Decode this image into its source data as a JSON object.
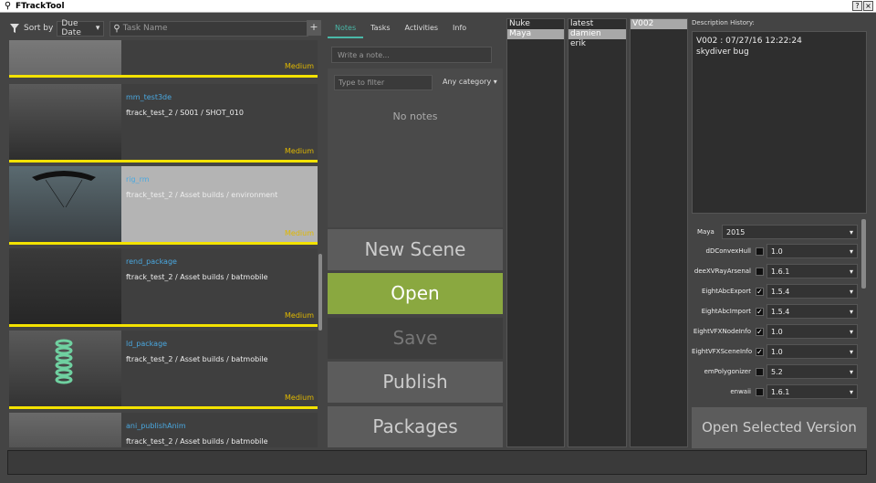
{
  "window": {
    "title": "FTrackTool",
    "help": "?",
    "close": "×"
  },
  "toolbar": {
    "sort_label": "Sort by",
    "sort_value": "Due Date",
    "search_placeholder": "Task Name",
    "add": "+"
  },
  "tasks": [
    {
      "name": "",
      "path": "",
      "priority": "Medium"
    },
    {
      "name": "mm_test3de",
      "path": "ftrack_test_2 / S001 / SHOT_010",
      "priority": "Medium"
    },
    {
      "name": "rig_rm",
      "path": "ftrack_test_2 / Asset builds / environment",
      "priority": "Medium"
    },
    {
      "name": "rend_package",
      "path": "ftrack_test_2 / Asset builds / batmobile",
      "priority": "Medium"
    },
    {
      "name": "ld_package",
      "path": "ftrack_test_2 / Asset builds / batmobile",
      "priority": "Medium"
    },
    {
      "name": "ani_publishAnim",
      "path": "ftrack_test_2 / Asset builds / batmobile",
      "priority": ""
    }
  ],
  "notes": {
    "tabs": [
      "Notes",
      "Tasks",
      "Activities",
      "Info"
    ],
    "write_placeholder": "Write a note...",
    "filter_placeholder": "Type to filter",
    "category": "Any category",
    "empty": "No notes"
  },
  "actions": {
    "new_scene": "New Scene",
    "open": "Open",
    "save": "Save",
    "publish": "Publish",
    "packages": "Packages"
  },
  "apps": [
    "Nuke",
    "Maya"
  ],
  "users": [
    "latest",
    "damien",
    "erik"
  ],
  "versions": [
    "V002"
  ],
  "description": {
    "label": "Description History:",
    "line1": "V002 : 07/27/16 12:22:24",
    "line2": "skydiver bug"
  },
  "maya": {
    "label": "Maya",
    "version": "2015"
  },
  "plugins": [
    {
      "name": "dDConvexHull",
      "checked": "",
      "version": "1.0"
    },
    {
      "name": "deeXVRayArsenal",
      "checked": "",
      "version": "1.6.1"
    },
    {
      "name": "EightAbcExport",
      "checked": "✓",
      "version": "1.5.4"
    },
    {
      "name": "EightAbcImport",
      "checked": "✓",
      "version": "1.5.4"
    },
    {
      "name": "EightVFXNodeInfo",
      "checked": "✓",
      "version": "1.0"
    },
    {
      "name": "EightVFXSceneInfo",
      "checked": "✓",
      "version": "1.0"
    },
    {
      "name": "emPolygonizer",
      "checked": "",
      "version": "5.2"
    },
    {
      "name": "enwaii",
      "checked": "",
      "version": "1.6.1"
    }
  ],
  "open_selected": "Open Selected Version"
}
